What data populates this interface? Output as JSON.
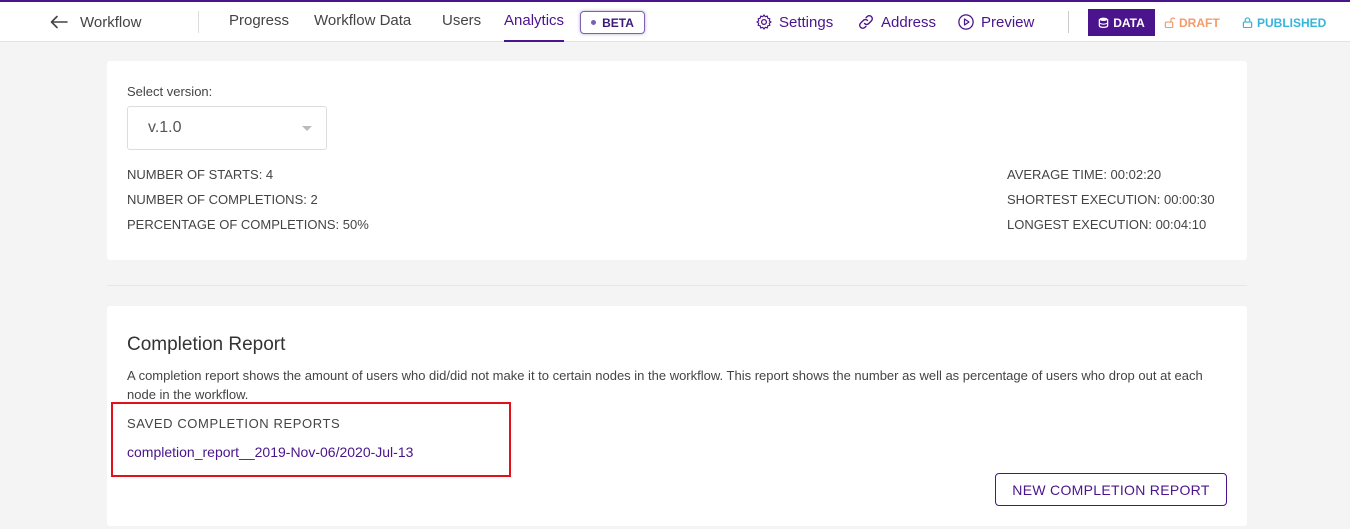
{
  "header": {
    "back_label": "Workflow",
    "tabs": [
      {
        "label": "Progress"
      },
      {
        "label": "Workflow Data"
      },
      {
        "label": "Users"
      },
      {
        "label": "Analytics",
        "active": true
      }
    ],
    "beta_badge": "BETA",
    "tools": {
      "settings": "Settings",
      "address": "Address",
      "preview": "Preview"
    },
    "modes": {
      "data": "DATA",
      "draft": "DRAFT",
      "published": "PUBLISHED"
    },
    "icons": [
      "arrow-left-icon",
      "gear-icon",
      "link-icon",
      "play-circle-icon",
      "database-icon",
      "unlock-icon",
      "lock-icon"
    ]
  },
  "version_panel": {
    "select_label": "Select version:",
    "selected_version": "v.1.0",
    "stats_left": [
      "NUMBER OF STARTS: 4",
      "NUMBER OF COMPLETIONS: 2",
      "PERCENTAGE OF COMPLETIONS: 50%"
    ],
    "stats_right": [
      "AVERAGE TIME: 00:02:20",
      "SHORTEST EXECUTION: 00:00:30",
      "LONGEST EXECUTION: 00:04:10"
    ]
  },
  "completion_report": {
    "title": "Completion Report",
    "description": "A completion report shows the amount of users who did/did not make it to certain nodes in the workflow. This report shows the number as well as percentage of users who drop out at each node in the workflow.",
    "saved_title": "SAVED COMPLETION REPORTS",
    "saved_reports": [
      "completion_report__2019-Nov-06/2020-Jul-13"
    ],
    "new_button": "NEW COMPLETION REPORT"
  },
  "colors": {
    "accent": "#4a148c",
    "draft": "#f29b6b",
    "published": "#35b6d9",
    "highlight": "#e0111b"
  }
}
